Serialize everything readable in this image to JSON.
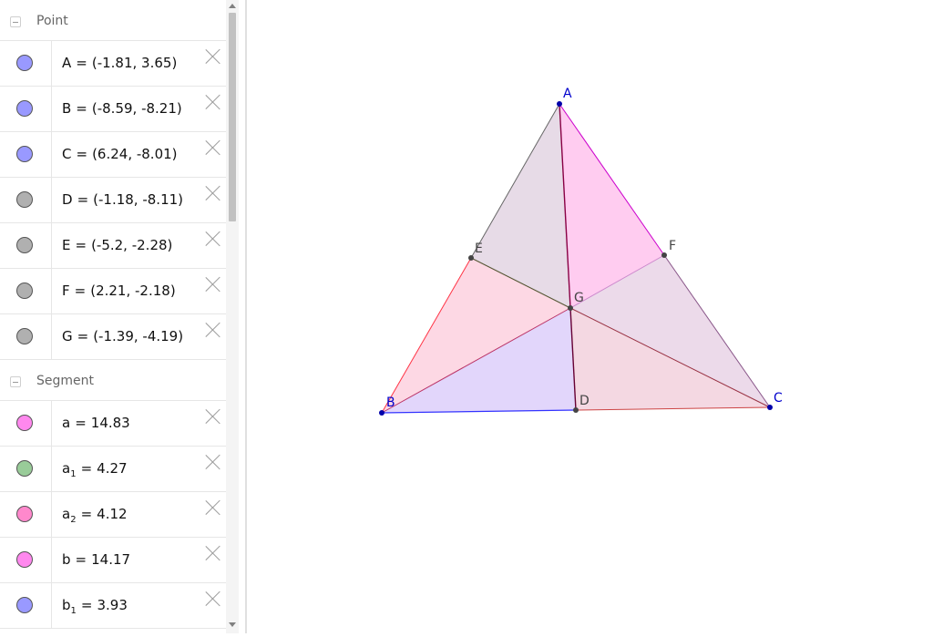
{
  "algebra": {
    "point_header": "Point",
    "segment_header": "Segment",
    "points": [
      {
        "name": "A",
        "value": "(-1.81, 3.65)",
        "color": "#9999ff"
      },
      {
        "name": "B",
        "value": "(-8.59, -8.21)",
        "color": "#9999ff"
      },
      {
        "name": "C",
        "value": "(6.24, -8.01)",
        "color": "#9999ff"
      },
      {
        "name": "D",
        "value": "(-1.18, -8.11)",
        "color": "#b0b0b0"
      },
      {
        "name": "E",
        "value": "(-5.2, -2.28)",
        "color": "#b0b0b0"
      },
      {
        "name": "F",
        "value": "(2.21, -2.18)",
        "color": "#b0b0b0"
      },
      {
        "name": "G",
        "value": "(-1.39, -4.19)",
        "color": "#b0b0b0"
      }
    ],
    "segments": [
      {
        "name": "a",
        "sub": "",
        "value": "14.83",
        "color": "#ff88ee"
      },
      {
        "name": "a",
        "sub": "1",
        "value": "4.27",
        "color": "#99cc99"
      },
      {
        "name": "a",
        "sub": "2",
        "value": "4.12",
        "color": "#ff88cc"
      },
      {
        "name": "b",
        "sub": "",
        "value": "14.17",
        "color": "#ff88ee"
      },
      {
        "name": "b",
        "sub": "1",
        "value": "3.93",
        "color": "#9999ff"
      }
    ],
    "equals": "="
  },
  "graphics": {
    "labels": {
      "A": "A",
      "B": "B",
      "C": "C",
      "D": "D",
      "E": "E",
      "F": "F",
      "G": "G"
    },
    "colors": {
      "free_point": "#0000aa",
      "dependent_point": "#444444",
      "label_free": "#0000cc",
      "label_dependent": "#444444"
    }
  }
}
